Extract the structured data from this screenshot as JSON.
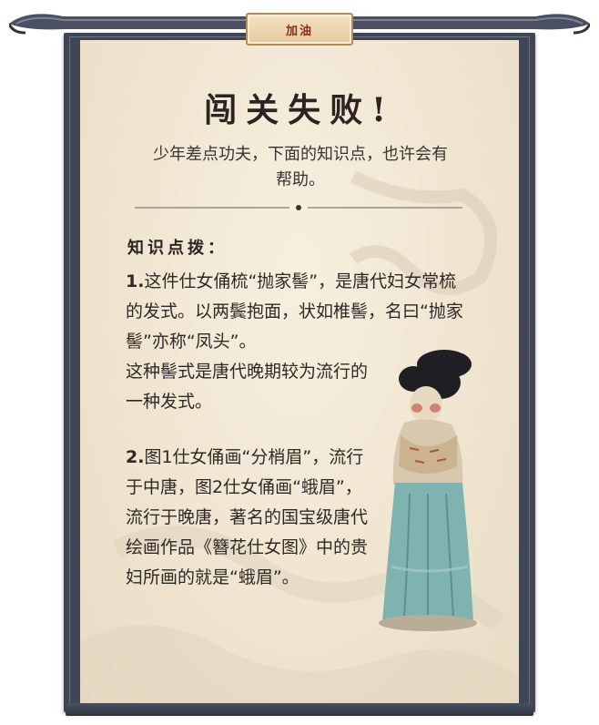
{
  "badge": {
    "label": "加油"
  },
  "title": "闯关失败!",
  "subtitle": "少年差点功夫，下面的知识点，也许会有帮助。",
  "section_heading": "知识点拨：",
  "points": [
    {
      "number": "1.",
      "text_full": "这件仕女俑梳“抛家髻”，是唐代妇女常梳的发式。以两鬓抱面，状如椎髻，名曰“抛家髻”亦称“凤头”。",
      "text_tail": "这种髻式是唐代晚期较为流行的一种发式。"
    },
    {
      "number": "2.",
      "text": "图1仕女俑画“分梢眉”，流行于中唐，图2仕女俑画“蛾眉”，流行于晚唐，著名的国宝级唐代绘画作品《簪花仕女图》中的贵妇所画的就是“蛾眉”。"
    }
  ],
  "colors": {
    "frame": "#3f4554",
    "paper": "#efe4cf",
    "badge_text": "#8c2a1e",
    "text": "#2f2826"
  },
  "icons": [
    "scroll-rod",
    "divider-dot",
    "tang-lady-figurine"
  ]
}
